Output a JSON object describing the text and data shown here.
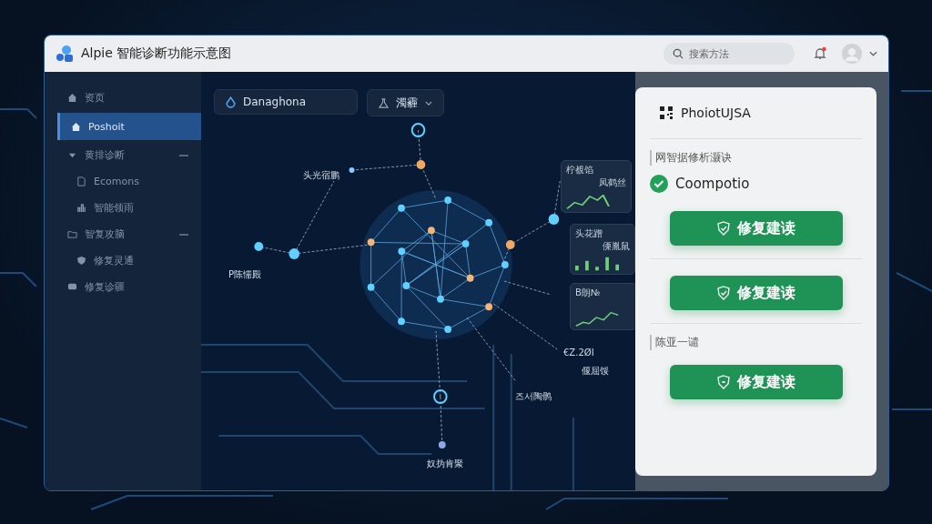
{
  "window": {
    "title": "Alpie 智能诊断功能示意图"
  },
  "header": {
    "search": {
      "placeholder": "搜索方法"
    },
    "notification": {
      "unread": true
    }
  },
  "sidebar": {
    "items": [
      {
        "label": "资页",
        "selected": false
      },
      {
        "label": "Poshoit",
        "selected": true
      },
      {
        "label": "黄排诊断",
        "selected": false,
        "expanded": true,
        "children": [
          {
            "label": "Ecomons",
            "selected": false
          },
          {
            "label": "智能领雨",
            "selected": false
          }
        ]
      },
      {
        "label": "智复攻脑",
        "selected": false,
        "expanded": true,
        "children": [
          {
            "label": "修复灵通",
            "selected": false
          }
        ]
      },
      {
        "label": "修复诊疆",
        "selected": false
      }
    ]
  },
  "toolbar": {
    "source": "Danaghona",
    "filter": "濁霾"
  },
  "graph": {
    "labels": [
      "头光宿鹏",
      "Р陈懦殿",
      "奴㧑肯聚",
      "€Z.2ØΙ",
      "偃屈馁",
      "즈서陶鹘"
    ],
    "cards": [
      {
        "title": "柠覩馅",
        "subtitle": "凤鹤丝"
      },
      {
        "title": "头花蹭",
        "subtitle": "傈胤鼠"
      },
      {
        "title": "B朗№"
      }
    ]
  },
  "panel": {
    "title": "PhoiotUJSA",
    "sections": [
      {
        "label": "网智据修析灏诀",
        "status": {
          "text": "Coompotio",
          "ok": true
        },
        "button": {
          "label": "修复建读"
        }
      },
      {
        "button": {
          "label": "修复建读"
        }
      },
      {
        "label": "陈亚一谴",
        "button": {
          "label": "修复建读"
        }
      }
    ]
  }
}
